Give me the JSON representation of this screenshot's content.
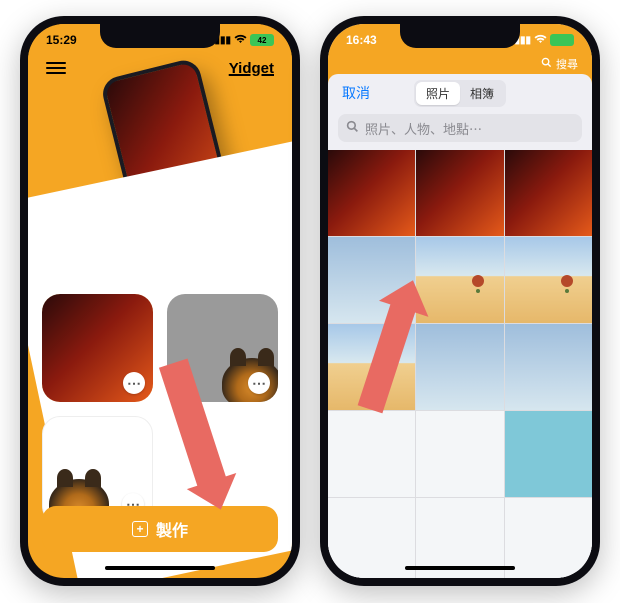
{
  "left": {
    "status": {
      "time": "15:29",
      "battery_text": "42"
    },
    "brand": "Yidget",
    "icons": {
      "menu": "hamburger-icon",
      "heart": "heart-icon",
      "bulb": "lightbulb-icon",
      "more": "⋯"
    },
    "tiles": [
      {
        "id": "red-gradient",
        "selected": true
      },
      {
        "id": "tiger-gray",
        "selected": false
      },
      {
        "id": "tiger-white",
        "selected": false
      }
    ],
    "make_button": {
      "label": "製作",
      "icon": "plus-box-icon"
    }
  },
  "right": {
    "status": {
      "time": "16:43",
      "battery_text": ""
    },
    "nav_search_hint": "搜尋",
    "picker": {
      "cancel": "取消",
      "segments": [
        "照片",
        "相簿"
      ],
      "selected_segment": 0,
      "search_placeholder": "照片、人物、地點⋯"
    }
  }
}
